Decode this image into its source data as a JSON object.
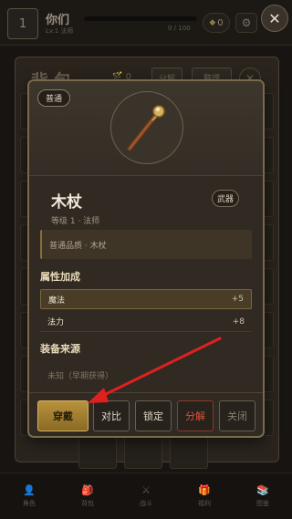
{
  "topbar": {
    "level": "1",
    "player_name": "你们",
    "player_sub": "Lv.1 法师",
    "exp_text": "0 / 100",
    "gems": "0",
    "gear_icon": "gear-icon",
    "close_icon": "close-icon"
  },
  "bag": {
    "title": "背包",
    "stat": "0",
    "decompose_label": "分解",
    "sort_label": "整理",
    "close_icon": "close-icon"
  },
  "nav": {
    "items": [
      {
        "label": "角色",
        "icon": "character-icon"
      },
      {
        "label": "背包",
        "icon": "bag-icon"
      },
      {
        "label": "战斗",
        "icon": "battle-icon"
      },
      {
        "label": "福利",
        "icon": "gift-icon"
      },
      {
        "label": "图鉴",
        "icon": "book-icon"
      }
    ]
  },
  "dialog": {
    "quality": "普通",
    "item_name": "木杖",
    "item_type": "武器",
    "meta": "等级 1 · 法师",
    "description": "普通品质 · 木杖",
    "attr_title": "属性加成",
    "attributes": [
      {
        "name": "魔法",
        "value": "+5",
        "highlight": true
      },
      {
        "name": "法力",
        "value": "+8",
        "highlight": false
      }
    ],
    "source_title": "装备来源",
    "source_text": "未知（早期获得）",
    "actions": {
      "equip": "穿戴",
      "compare": "对比",
      "lock": "锁定",
      "decompose": "分解",
      "close": "关闭"
    }
  },
  "colors": {
    "accent_gold": "#b8923c",
    "danger_red": "#e0503a",
    "pointer_arrow": "#e02020"
  }
}
